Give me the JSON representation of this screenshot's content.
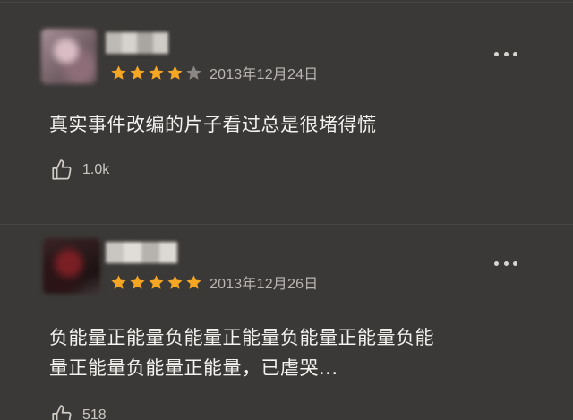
{
  "colors": {
    "background": "#3b3937",
    "star_filled": "#f5a623",
    "star_empty": "#8a8683",
    "text_primary": "#f4f2ef",
    "text_secondary": "#bab6b2"
  },
  "reviews": [
    {
      "avatar_icon": "blurred-user-avatar",
      "rating": 4,
      "rating_max": 5,
      "date": "2013年12月24日",
      "text": "真实事件改编的片子看过总是很堵得慌",
      "likes": "1.0k",
      "more_icon": "more-dots-icon",
      "like_icon": "thumbs-up-icon"
    },
    {
      "avatar_icon": "blurred-user-avatar",
      "rating": 5,
      "rating_max": 5,
      "date": "2013年12月26日",
      "text_line1": "负能量正能量负能量正能量负能量正能量负能",
      "text_line2": "量正能量负能量正能量，已虐哭...",
      "likes": "518",
      "more_icon": "more-dots-icon",
      "like_icon": "thumbs-up-icon"
    }
  ]
}
